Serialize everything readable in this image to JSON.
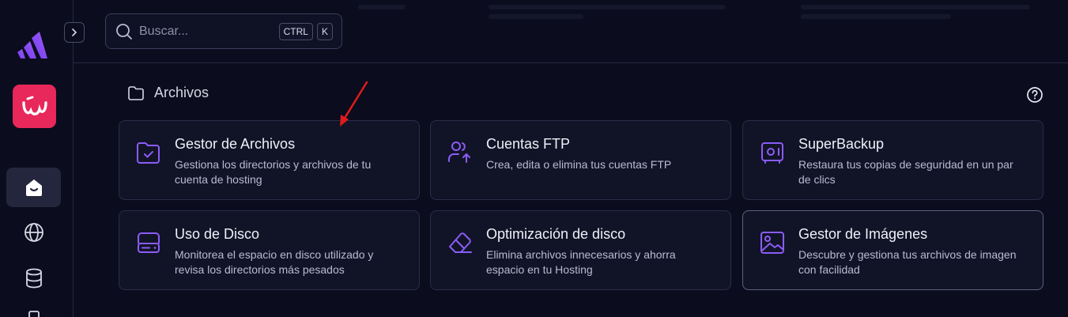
{
  "search": {
    "placeholder": "Buscar...",
    "shortcut_keys": [
      "CTRL",
      "K"
    ]
  },
  "section": {
    "title": "Archivos"
  },
  "cards": [
    {
      "title": "Gestor de Archivos",
      "description": "Gestiona los directorios y archivos de tu cuenta de hosting",
      "icon": "folder-check-icon"
    },
    {
      "title": "Cuentas FTP",
      "description": "Crea, edita o elimina tus cuentas FTP",
      "icon": "users-upload-icon"
    },
    {
      "title": "SuperBackup",
      "description": "Restaura tus copias de seguridad en un par de clics",
      "icon": "safe-icon"
    },
    {
      "title": "Uso de Disco",
      "description": "Monitorea el espacio en disco utilizado y revisa los directorios más pesados",
      "icon": "hard-drive-icon"
    },
    {
      "title": "Optimización de disco",
      "description": "Elimina archivos innecesarios y ahorra espacio en tu Hosting",
      "icon": "eraser-icon"
    },
    {
      "title": "Gestor de Imágenes",
      "description": "Descubre y gestiona tus archivos de imagen con facilidad",
      "icon": "image-icon"
    }
  ],
  "sidebar": {
    "items": [
      {
        "icon": "home-icon",
        "active": true
      },
      {
        "icon": "globe-icon",
        "active": false
      },
      {
        "icon": "database-icon",
        "active": false
      }
    ]
  },
  "colors": {
    "background": "#0b0c1e",
    "card": "#111427",
    "accent": "#8b5cf6",
    "brand_red": "#e8275a",
    "annotation_arrow": "#e01b1b"
  }
}
